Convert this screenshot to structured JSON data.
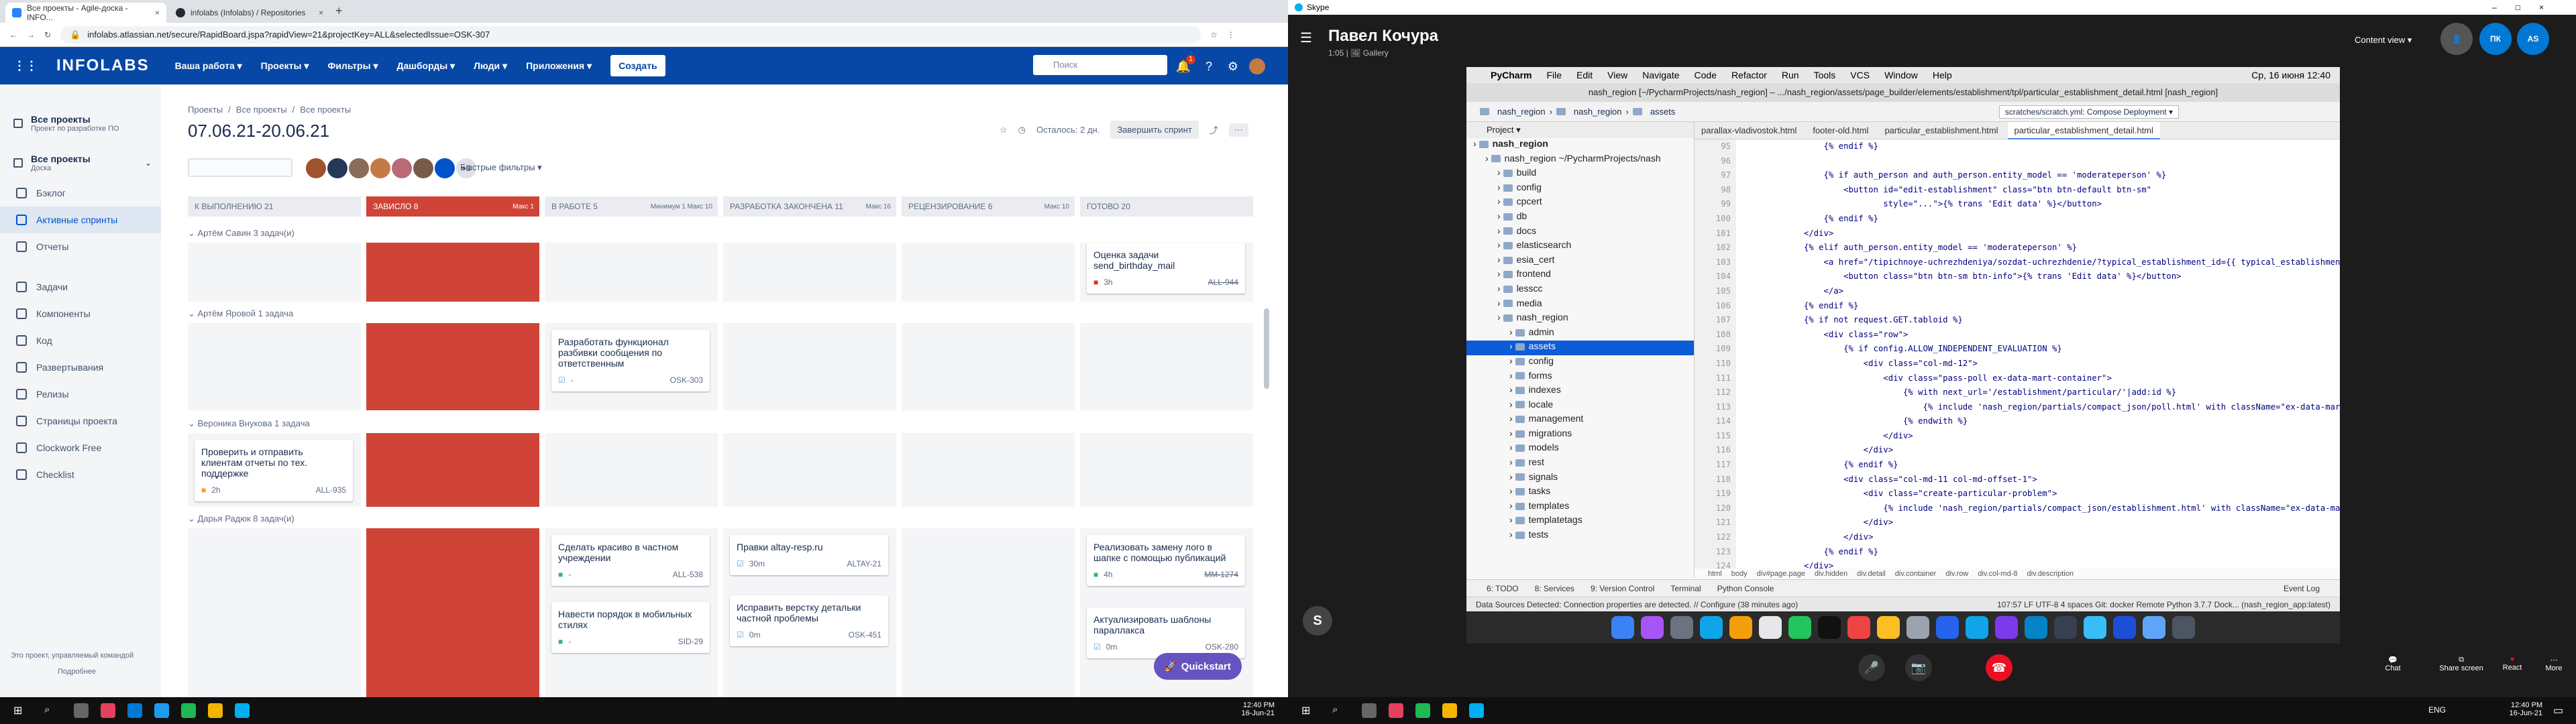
{
  "browser": {
    "tabs": [
      {
        "title": "Все проекты - Agile-доска - INFO...",
        "color": "#2684ff"
      },
      {
        "title": "infolabs (Infolabs) / Repositories",
        "color": "#24292e"
      }
    ],
    "url": "infolabs.atlassian.net/secure/RapidBoard.jspa?rapidView=21&projectKey=ALL&selectedIssue=OSK-307"
  },
  "jira_nav": {
    "logo": "INFOLABS",
    "items": [
      "Ваша работа ▾",
      "Проекты ▾",
      "Фильтры ▾",
      "Дашборды ▾",
      "Люди ▾",
      "Приложения ▾"
    ],
    "create": "Создать",
    "search_placeholder": "Поиск",
    "badge": "1"
  },
  "sidebar": {
    "project_title": "Все проекты",
    "project_sub": "Проект по разработке ПО",
    "board_title": "Все проекты",
    "board_sub": "Доска",
    "items": [
      "Бэклог",
      "Активные спринты",
      "Отчеты",
      "Задачи",
      "Компоненты",
      "Код",
      "Развертывания",
      "Релизы",
      "Страницы проекта",
      "Clockwork Free",
      "Checklist"
    ],
    "footer": "Это проект, управляемый командой",
    "footer_link": "Подробнее"
  },
  "board": {
    "breadcrumb": [
      "Проекты",
      "Все проекты",
      "Все проекты"
    ],
    "title": "07.06.21-20.06.21",
    "remaining": "Осталось: 2 дн.",
    "complete_sprint": "Завершить спринт",
    "quick_filters": "Быстрые фильтры ▾",
    "avatar_more": "+3",
    "columns": [
      {
        "name": "К ВЫПОЛНЕНИЮ 21",
        "red": false,
        "limit": ""
      },
      {
        "name": "ЗАВИСЛО 8",
        "red": true,
        "limit": "Макс 1"
      },
      {
        "name": "В РАБОТЕ 5",
        "red": false,
        "limit": "Минимум 1  Макс 10"
      },
      {
        "name": "РАЗРАБОТКА ЗАКОНЧЕНА 11",
        "red": false,
        "limit": "Макс 16"
      },
      {
        "name": "РЕЦЕНЗИРОВАНИЕ 6",
        "red": false,
        "limit": "Макс 10"
      },
      {
        "name": "ГОТОВО 20",
        "red": false,
        "limit": ""
      }
    ],
    "lanes": [
      {
        "header": "⌄ Артём Савин  3 задач(и)",
        "cards": [
          {
            "col": 5,
            "text": "Оценка задачи send_birthday_mail",
            "est": "3h",
            "key": "ALL-944"
          }
        ]
      },
      {
        "header": "⌄ Артём Яровой  1 задача",
        "cards": [
          {
            "col": 2,
            "text": "Разработать функционал разбивки сообщения по ответственным",
            "est": "-",
            "key": "OSK-303"
          }
        ]
      },
      {
        "header": "⌄ Вероника Внукова  1 задача",
        "cards": [
          {
            "col": 0,
            "text": "Проверить и отправить клиентам отчеты по тех. поддержке",
            "est": "2h",
            "key": "ALL-935"
          }
        ]
      },
      {
        "header": "⌄ Дарья Радюк  8 задач(и)",
        "cards": [
          {
            "col": 2,
            "text": "Сделать красиво в частном учреждении",
            "est": "-",
            "key": "ALL-538"
          },
          {
            "col": 3,
            "text": "Правки altay-resp.ru",
            "est": "30m",
            "key": "ALTAY-21"
          },
          {
            "col": 5,
            "text": "Реализовать замену лого в шапке с помощью публикаций",
            "est": "4h",
            "key": "MM-1274"
          },
          {
            "col": 2,
            "text": "Навести порядок в мобильных стилях",
            "est": "-",
            "key": "SID-29"
          },
          {
            "col": 3,
            "text": "Исправить верстку детальки частной проблемы",
            "est": "0m",
            "key": "OSK-451"
          },
          {
            "col": 5,
            "text": "Актуализировать шаблоны параллакса",
            "est": "0m",
            "key": "OSK-280"
          }
        ]
      }
    ],
    "quickstart": "Quickstart"
  },
  "skype": {
    "window_title": "Skype",
    "contact": "Павел Кочура",
    "contact_sub": "1:05 | 🖼 Gallery",
    "content_view": "Content view ▾",
    "avatars": [
      "ПК",
      "AS"
    ],
    "avatar_color": "#0078d4"
  },
  "mac": {
    "menu": [
      "",
      "PyCharm",
      "File",
      "Edit",
      "View",
      "Navigate",
      "Code",
      "Refactor",
      "Run",
      "Tools",
      "VCS",
      "Window",
      "Help"
    ],
    "clock": "Ср, 16 июня  12:40",
    "title": "nash_region [~/PycharmProjects/nash_region] – .../nash_region/assets/page_builder/elements/establishment/tpl/particular_establishment_detail.html [nash_region]",
    "breadcrumb": [
      "nash_region",
      "nash_region",
      "assets"
    ],
    "run_config": "scratches/scratch.yml: Compose Deployment ▾",
    "project_label": "Project ▾",
    "tree": [
      {
        "label": "nash_region",
        "depth": 0,
        "sel": false,
        "bold": true
      },
      {
        "label": "nash_region  ~/PycharmProjects/nash",
        "depth": 1,
        "sel": false
      },
      {
        "label": "build",
        "depth": 2,
        "sel": false
      },
      {
        "label": "config",
        "depth": 2,
        "sel": false
      },
      {
        "label": "cpcert",
        "depth": 2,
        "sel": false
      },
      {
        "label": "db",
        "depth": 2,
        "sel": false
      },
      {
        "label": "docs",
        "depth": 2,
        "sel": false
      },
      {
        "label": "elasticsearch",
        "depth": 2,
        "sel": false
      },
      {
        "label": "esia_cert",
        "depth": 2,
        "sel": false
      },
      {
        "label": "frontend",
        "depth": 2,
        "sel": false
      },
      {
        "label": "lesscc",
        "depth": 2,
        "sel": false
      },
      {
        "label": "media",
        "depth": 2,
        "sel": false
      },
      {
        "label": "nash_region",
        "depth": 2,
        "sel": false
      },
      {
        "label": "admin",
        "depth": 3,
        "sel": false
      },
      {
        "label": "assets",
        "depth": 3,
        "sel": true
      },
      {
        "label": "config",
        "depth": 3,
        "sel": false
      },
      {
        "label": "forms",
        "depth": 3,
        "sel": false
      },
      {
        "label": "indexes",
        "depth": 3,
        "sel": false
      },
      {
        "label": "locale",
        "depth": 3,
        "sel": false
      },
      {
        "label": "management",
        "depth": 3,
        "sel": false
      },
      {
        "label": "migrations",
        "depth": 3,
        "sel": false
      },
      {
        "label": "models",
        "depth": 3,
        "sel": false
      },
      {
        "label": "rest",
        "depth": 3,
        "sel": false
      },
      {
        "label": "signals",
        "depth": 3,
        "sel": false
      },
      {
        "label": "tasks",
        "depth": 3,
        "sel": false
      },
      {
        "label": "templates",
        "depth": 3,
        "sel": false
      },
      {
        "label": "templatetags",
        "depth": 3,
        "sel": false
      },
      {
        "label": "tests",
        "depth": 3,
        "sel": false
      }
    ],
    "editor_tabs": [
      "parallax-vladivostok.html",
      "footer-old.html",
      "particular_establishment.html",
      "particular_establishment_detail.html"
    ],
    "code_start_line": 95,
    "code": [
      "                {% endif %}",
      "",
      "                {% if auth_person and auth_person.entity_model == 'moderateperson' %}",
      "                    <button id=\"edit-establishment\" class=\"btn btn-default btn-sm\"",
      "                            style=\"...\">{% trans 'Edit data' %}</button>",
      "                {% endif %}",
      "            </div>",
      "            {% elif auth_person.entity_model == 'moderateperson' %}",
      "                <a href=\"/tipichnoye-uchrezhdeniya/sozdat-uchrezhdenie/?typical_establishment_id={{ typical_establishment.id }}&est",
      "                    <button class=\"btn btn-sm btn-info\">{% trans 'Edit data' %}</button>",
      "                </a>",
      "            {% endif %}",
      "            {% if not request.GET.tabloid %}",
      "                <div class=\"row\">",
      "                    {% if config.ALLOW_INDEPENDENT_EVALUATION %}",
      "                        <div class=\"col-md-12\">",
      "                            <div class=\"pass-poll ex-data-mart-container\">",
      "                                {% with next_url='/establishment/particular/'|add:id %}",
      "                                    {% include 'nash_region/partials/compact_json/poll.html' with className=\"ex-data-mart ex-catal",
      "                                {% endwith %}",
      "                            </div>",
      "                        </div>",
      "                    {% endif %}",
      "                    <div class=\"col-md-11 col-md-offset-1\">",
      "                        <div class=\"create-particular-problem\">",
      "                            {% include 'nash_region/partials/compact_json/establishment.html' with className=\"ex-data-mart ex-cata",
      "                        </div>",
      "                    </div>",
      "                {% endif %}",
      "            </div>"
    ],
    "code_breadcrumb": [
      "html",
      "body",
      "div#page.page",
      "div.hidden",
      "div.detail",
      "div.container",
      "div.row",
      "div.col-md-8",
      "div.description"
    ],
    "toolstrip": [
      "6: TODO",
      "8: Services",
      "9: Version Control",
      "Terminal",
      "Python Console",
      "Event Log"
    ],
    "status_left": "Data Sources Detected: Connection properties are detected. // Configure (38 minutes ago)",
    "status_right": "107:57  LF  UTF-8  4 spaces  Git: docker  Remote Python 3.7.7 Dock... (nash_region_app:latest)"
  },
  "call": {
    "buttons": [
      "Chat",
      "Share screen",
      "React",
      "More"
    ]
  },
  "taskbar": {
    "left_clock": "12:40 PM",
    "left_date": "16-Jun-21",
    "right_clock": "12:40 PM",
    "right_date": "16-Jun-21",
    "lang": "ENG"
  }
}
